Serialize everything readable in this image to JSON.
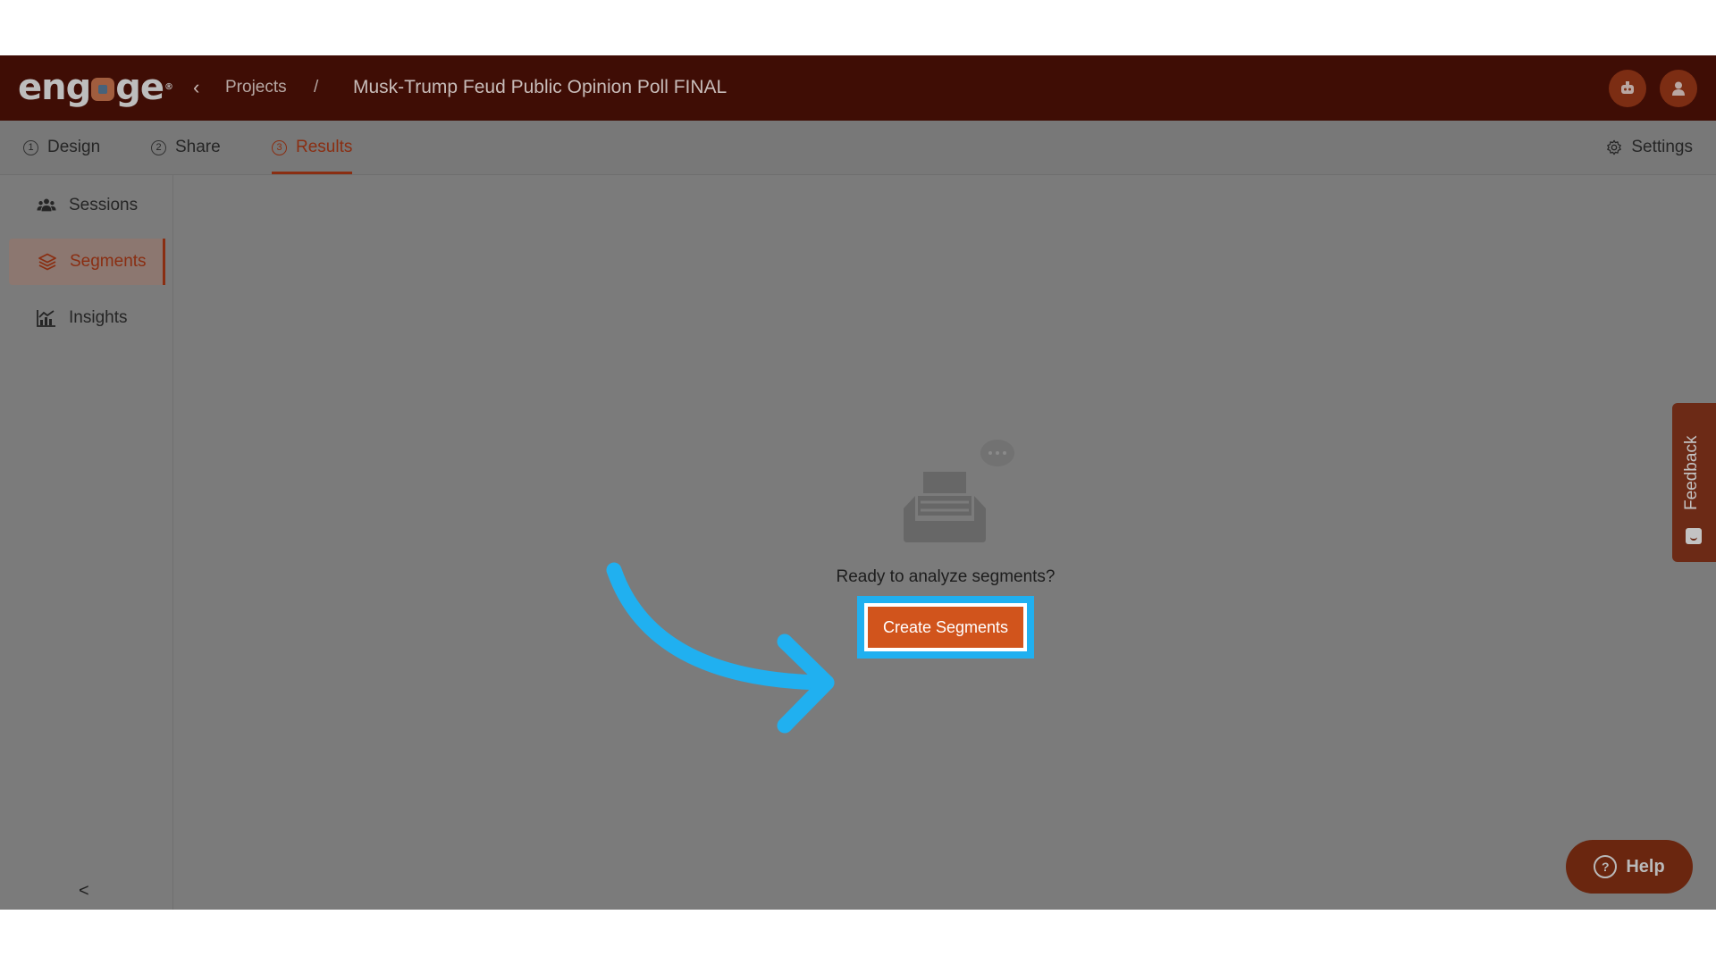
{
  "header": {
    "logo_text": "engage",
    "breadcrumb_link": "Projects",
    "breadcrumb_separator": "/",
    "project_title": "Musk-Trump Feud Public Opinion Poll FINAL",
    "icons": {
      "back": "chevron-left-icon",
      "assistant": "bot-icon",
      "profile": "user-icon"
    }
  },
  "tabs": [
    {
      "number": "1",
      "label": "Design"
    },
    {
      "number": "2",
      "label": "Share"
    },
    {
      "number": "3",
      "label": "Results",
      "active": true
    }
  ],
  "settings_label": "Settings",
  "sidebar": {
    "items": [
      {
        "label": "Sessions",
        "icon": "users-icon"
      },
      {
        "label": "Segments",
        "icon": "layers-icon",
        "active": true
      },
      {
        "label": "Insights",
        "icon": "chart-icon"
      }
    ],
    "collapse_glyph": "<"
  },
  "empty_state": {
    "message": "Ready to analyze segments?",
    "button_label": "Create Segments"
  },
  "feedback_label": "Feedback",
  "help_label": "Help",
  "colors": {
    "header_bg": "#3f0d05",
    "accent": "#8a2e12",
    "cta": "#d1541c",
    "highlight": "#20b0f0"
  }
}
